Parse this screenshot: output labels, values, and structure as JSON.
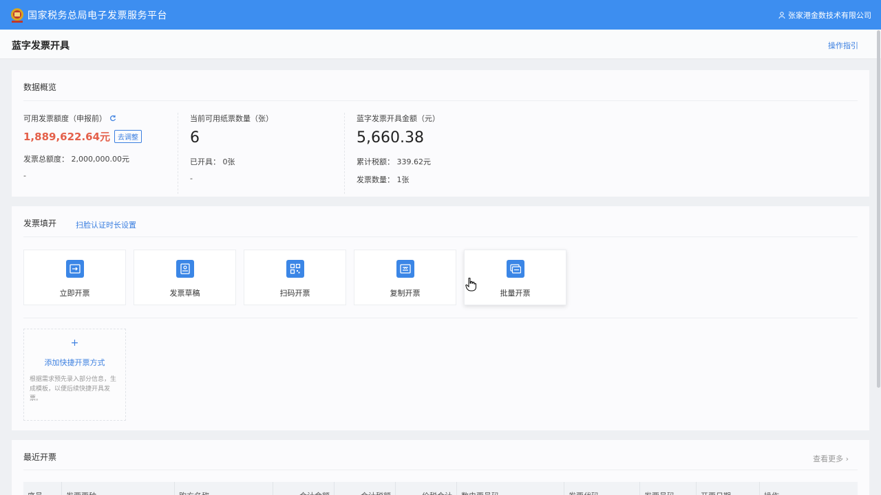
{
  "header": {
    "app_title": "国家税务总局电子发票服务平台",
    "user_name": "张家港金数技术有限公司"
  },
  "page": {
    "title": "蓝字发票开具",
    "guide_link": "操作指引"
  },
  "overview": {
    "title": "数据概览",
    "stats": [
      {
        "label": "可用发票额度（申报前）",
        "value": "1,889,622.64元",
        "button": "去调整",
        "sub1": "发票总额度：  2,000,000.00元",
        "sub2": "-"
      },
      {
        "label": "当前可用纸票数量（张）",
        "value": "6",
        "sub1": "已开具：  0张",
        "sub2": "-"
      },
      {
        "label": "蓝字发票开具金额（元）",
        "value": "5,660.38",
        "sub1": "累计税额：  339.62元",
        "sub2": "发票数量：  1张"
      }
    ]
  },
  "quick": {
    "title": "发票填开",
    "settings_link": "扫脸认证时长设置",
    "tiles": [
      {
        "label": "立即开票",
        "icon": "ticket-arrow-icon"
      },
      {
        "label": "发票草稿",
        "icon": "draft-icon"
      },
      {
        "label": "扫码开票",
        "icon": "qrcode-icon"
      },
      {
        "label": "复制开票",
        "icon": "copy-ticket-icon"
      },
      {
        "label": "批量开票",
        "icon": "batch-ticket-icon"
      }
    ],
    "add_tile": {
      "plus": "+",
      "label": "添加快捷开票方式",
      "description": "根据需求预先录入部分信息，生成模板，以便后续快捷开具发票。"
    }
  },
  "recent": {
    "title": "最近开票",
    "more_link": "查看更多",
    "columns": [
      "序号",
      "发票票种",
      "购方名称",
      "合计金额",
      "合计税额",
      "价税合计",
      "数电票号码",
      "发票代码",
      "发票号码",
      "开票日期",
      "操作"
    ]
  },
  "colors": {
    "topbar": "#3d8ef0",
    "accent": "#3b7fe0",
    "amount_red": "#e4604a"
  }
}
